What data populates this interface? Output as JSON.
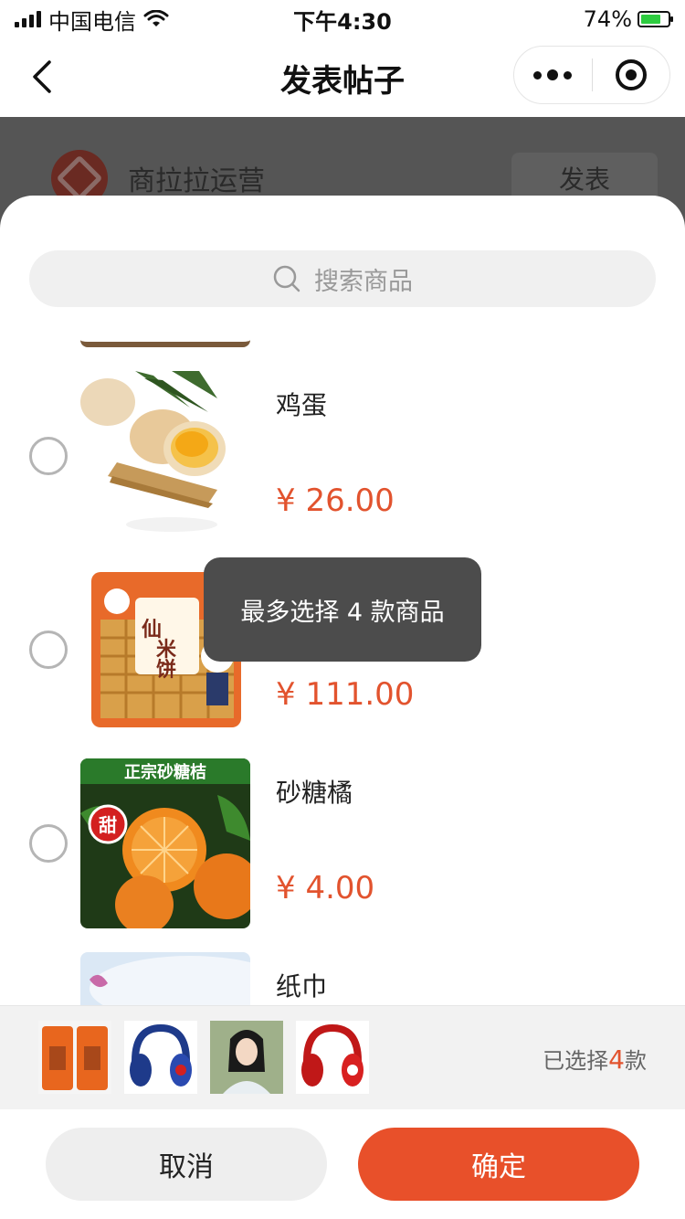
{
  "status_bar": {
    "carrier": "中国电信",
    "time": "下午4:30",
    "battery": "74%",
    "battery_level": 0.74
  },
  "nav": {
    "title": "发表帖子",
    "back_icon": "chevron-left-icon",
    "more_icon": "more-dots-icon",
    "close_icon": "target-circle-icon"
  },
  "background": {
    "account_name": "商拉拉运营",
    "publish_label": "发表"
  },
  "search": {
    "placeholder": "搜索商品"
  },
  "products": [
    {
      "name": "鸡蛋",
      "price": "¥ 26.00",
      "image": "eggs"
    },
    {
      "name": "",
      "price": "¥ 111.00",
      "image": "rice-crackers"
    },
    {
      "name": "砂糖橘",
      "price": "¥ 4.00",
      "image": "mandarin-oranges",
      "banner": "正宗砂糖桔",
      "badge": "甜"
    },
    {
      "name": "纸巾",
      "price": "",
      "image": "tissue"
    }
  ],
  "rice_cracker_label": "仙米饼",
  "toast": {
    "message": "最多选择 4 款商品"
  },
  "selected": {
    "prefix": "已选择",
    "count": "4",
    "suffix": "款",
    "thumbnails": [
      "orange-tea-boxes",
      "blue-headphones",
      "woman-portrait",
      "red-headphones"
    ]
  },
  "actions": {
    "cancel": "取消",
    "confirm": "确定"
  },
  "colors": {
    "accent": "#e8502a",
    "price": "#e2532e",
    "toast_bg": "#4c4c4c"
  }
}
